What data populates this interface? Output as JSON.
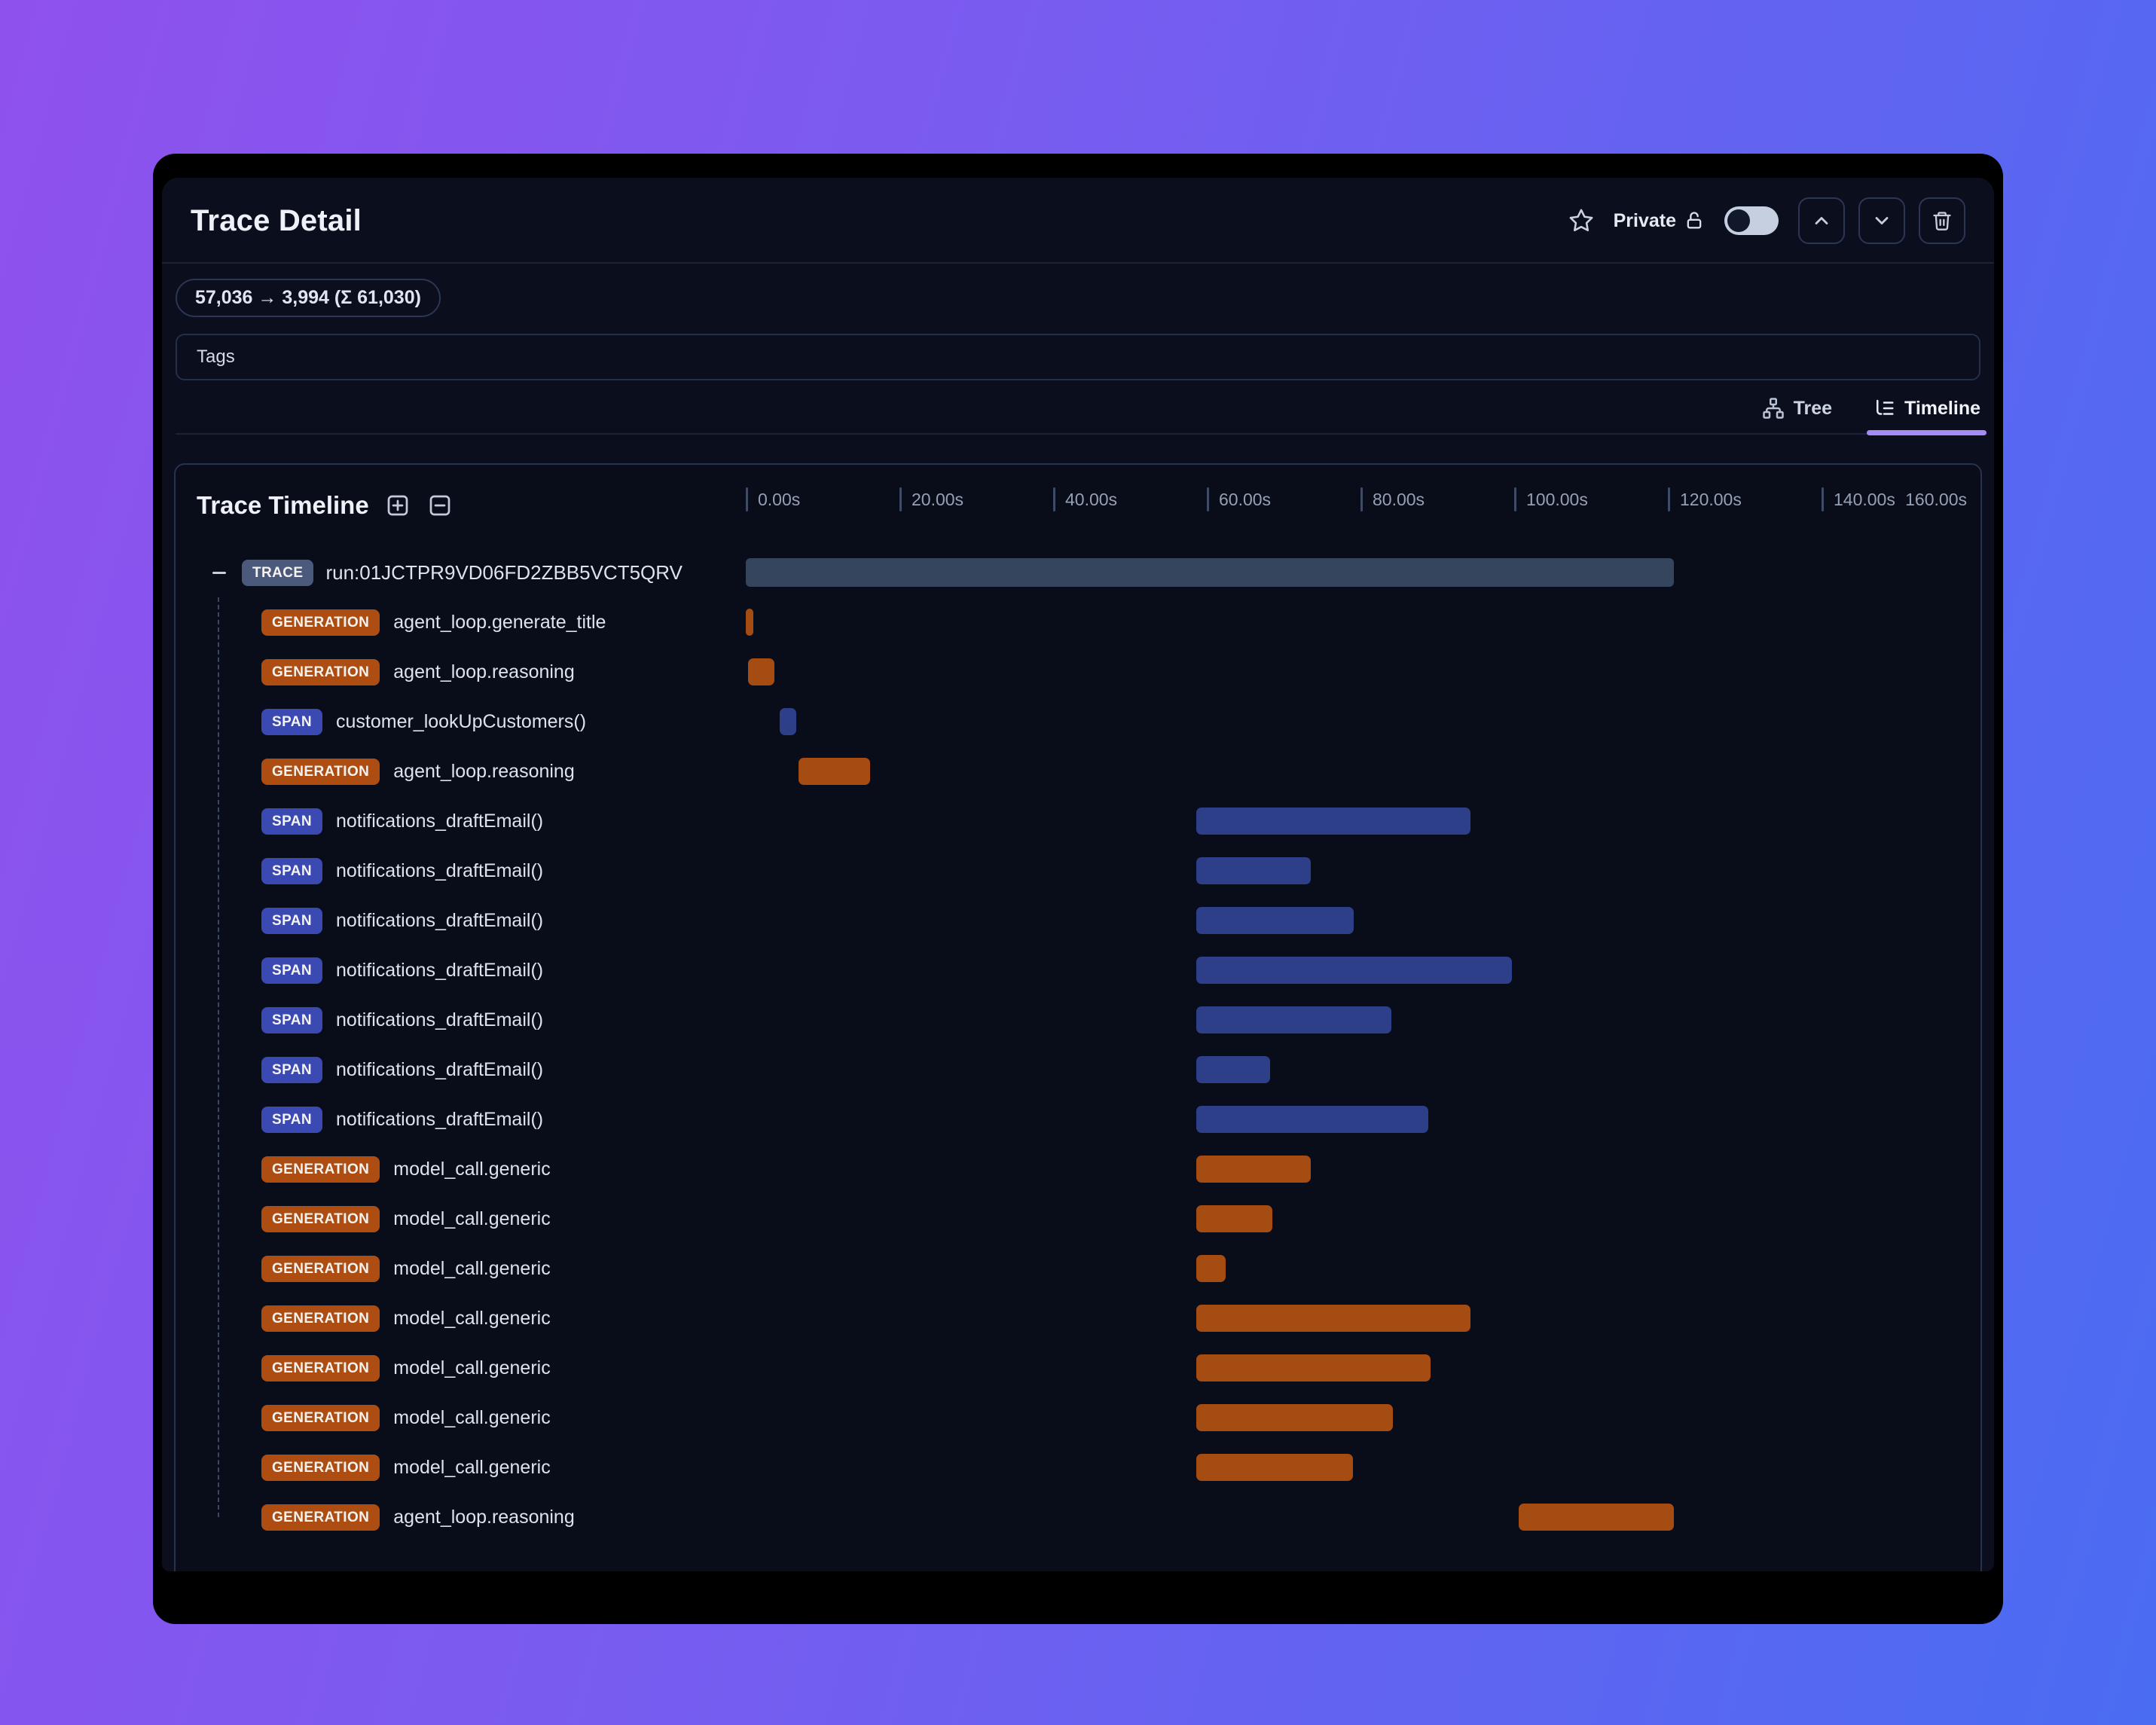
{
  "header": {
    "title": "Trace Detail",
    "privacy_label": "Private",
    "favorite_icon": "star",
    "bookmark_toggle_on": false
  },
  "token_usage": "57,036 → 3,994 (Σ 61,030)",
  "tags": {
    "label": "Tags"
  },
  "view_tabs": [
    {
      "label": "Tree",
      "icon": "org-chart",
      "active": false
    },
    {
      "label": "Timeline",
      "icon": "list-tree",
      "active": true
    }
  ],
  "timeline": {
    "title": "Trace Timeline",
    "axis": {
      "unit": "seconds",
      "ticks": [
        {
          "label": "0.00s",
          "s": 0
        },
        {
          "label": "20.00s",
          "s": 20
        },
        {
          "label": "40.00s",
          "s": 40
        },
        {
          "label": "60.00s",
          "s": 60
        },
        {
          "label": "80.00s",
          "s": 80
        },
        {
          "label": "100.00s",
          "s": 100
        },
        {
          "label": "120.00s",
          "s": 120
        },
        {
          "label": "140.00s",
          "s": 140
        },
        {
          "label": "160.00s",
          "s": 160
        }
      ]
    },
    "rows": [
      {
        "type": "TRACE",
        "name": "run:01JCTPR9VD06FD2ZBB5VCT5QRV",
        "start_s": 0,
        "end_s": 120.8,
        "root": true
      },
      {
        "type": "GENERATION",
        "name": "agent_loop.generate_title",
        "start_s": 0,
        "end_s": 1.0
      },
      {
        "type": "GENERATION",
        "name": "agent_loop.reasoning",
        "start_s": 0.3,
        "end_s": 3.7
      },
      {
        "type": "SPAN",
        "name": "customer_lookUpCustomers()",
        "start_s": 4.4,
        "end_s": 6.6
      },
      {
        "type": "GENERATION",
        "name": "agent_loop.reasoning",
        "start_s": 6.9,
        "end_s": 16.2
      },
      {
        "type": "SPAN",
        "name": "notifications_draftEmail()",
        "start_s": 58.6,
        "end_s": 94.3
      },
      {
        "type": "SPAN",
        "name": "notifications_draftEmail()",
        "start_s": 58.6,
        "end_s": 73.5
      },
      {
        "type": "SPAN",
        "name": "notifications_draftEmail()",
        "start_s": 58.6,
        "end_s": 79.1
      },
      {
        "type": "SPAN",
        "name": "notifications_draftEmail()",
        "start_s": 58.6,
        "end_s": 99.7
      },
      {
        "type": "SPAN",
        "name": "notifications_draftEmail()",
        "start_s": 58.6,
        "end_s": 84.0
      },
      {
        "type": "SPAN",
        "name": "notifications_draftEmail()",
        "start_s": 58.6,
        "end_s": 68.2
      },
      {
        "type": "SPAN",
        "name": "notifications_draftEmail()",
        "start_s": 58.6,
        "end_s": 88.8
      },
      {
        "type": "GENERATION",
        "name": "model_call.generic",
        "start_s": 58.6,
        "end_s": 73.5
      },
      {
        "type": "GENERATION",
        "name": "model_call.generic",
        "start_s": 58.6,
        "end_s": 68.5
      },
      {
        "type": "GENERATION",
        "name": "model_call.generic",
        "start_s": 58.6,
        "end_s": 62.5
      },
      {
        "type": "GENERATION",
        "name": "model_call.generic",
        "start_s": 58.6,
        "end_s": 94.3
      },
      {
        "type": "GENERATION",
        "name": "model_call.generic",
        "start_s": 58.6,
        "end_s": 89.1
      },
      {
        "type": "GENERATION",
        "name": "model_call.generic",
        "start_s": 58.6,
        "end_s": 84.2
      },
      {
        "type": "GENERATION",
        "name": "model_call.generic",
        "start_s": 58.6,
        "end_s": 79.0
      },
      {
        "type": "GENERATION",
        "name": "agent_loop.reasoning",
        "start_s": 100.6,
        "end_s": 120.8
      }
    ]
  },
  "colors": {
    "background_gradient_start": "#8f51ee",
    "background_gradient_end": "#4a6cf2",
    "window": "#000000",
    "surface": "#0b0f1d",
    "panel": "#090d19",
    "accent_tab_underline": "#a48bf7",
    "trace_badge": "#4b5a7c",
    "generation_badge": "#ad4d11",
    "span_badge": "#3b4ab2",
    "trace_bar": "#35455e",
    "generation_bar": "#a54c13",
    "span_bar": "#2c3f88",
    "toggle_track": "#c6cfdf",
    "toggle_knob": "#101829"
  }
}
